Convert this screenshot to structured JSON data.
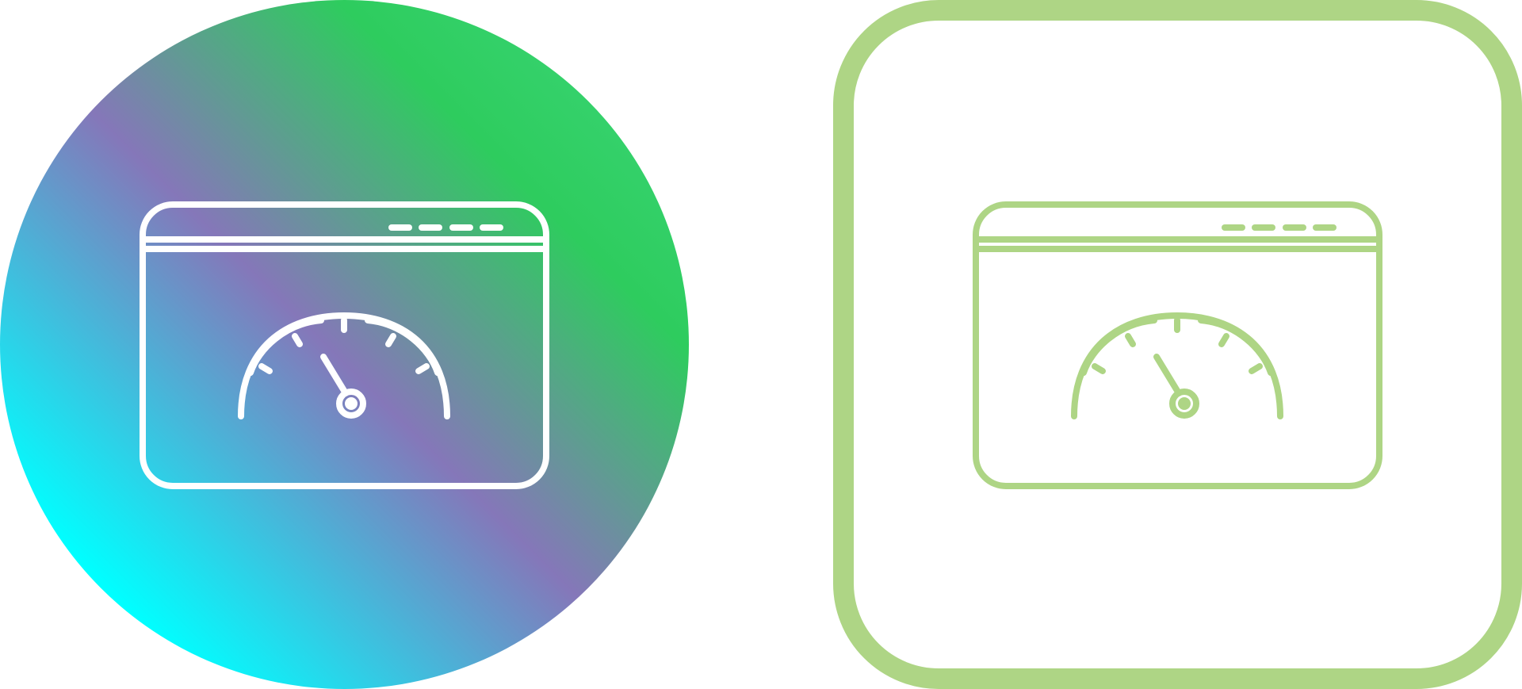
{
  "icons": [
    {
      "name": "speedometer-browser-icon",
      "style": "gradient-circle",
      "background_colors": [
        "#00ffff",
        "#8577b9",
        "#2ecc5e",
        "#34d16a"
      ],
      "stroke_color": "#ffffff"
    },
    {
      "name": "speedometer-browser-icon",
      "style": "outline-rounded-square",
      "frame_color": "#aed585",
      "stroke_color": "#aed585"
    }
  ]
}
